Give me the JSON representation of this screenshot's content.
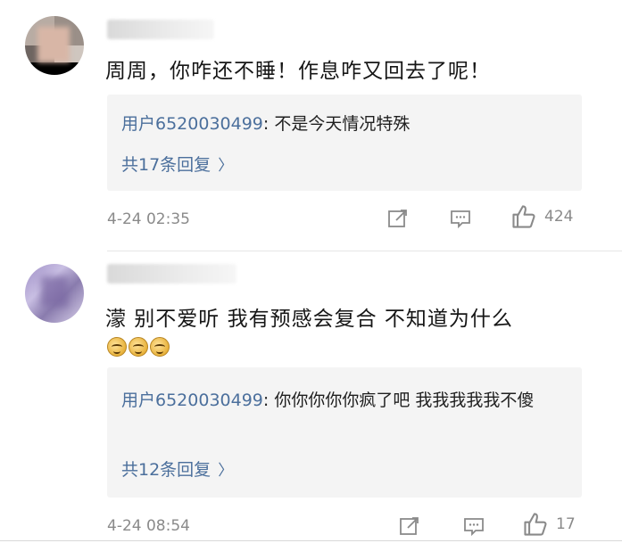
{
  "comments": [
    {
      "text": "周周，你咋还不睡！作息咋又回去了呢！",
      "reply": {
        "user": "用户6520030499",
        "sep": ": ",
        "text": "不是今天情况特殊",
        "more_label": "共17条回复",
        "chevron": "〉"
      },
      "time": "4-24 02:35",
      "likes": "424"
    },
    {
      "text": "濛 别不爱听 我有预感会复合 不知道为什么",
      "emoji_icons": [
        "laugh-cry-icon",
        "laugh-cry-icon",
        "laugh-cry-icon"
      ],
      "reply": {
        "user": "用户6520030499",
        "sep": ": ",
        "text": "你你你你你疯了吧 我我我我我不傻",
        "more_label": "共12条回复",
        "chevron": "〉"
      },
      "time": "4-24 08:54",
      "likes": "17"
    }
  ],
  "colors": {
    "link": "#4b6f9c",
    "meta": "#8a8a8a",
    "reply_bg": "#f4f4f4"
  },
  "icons": {
    "share": "share-icon",
    "comment": "comment-icon",
    "like": "thumbs-up-icon"
  }
}
